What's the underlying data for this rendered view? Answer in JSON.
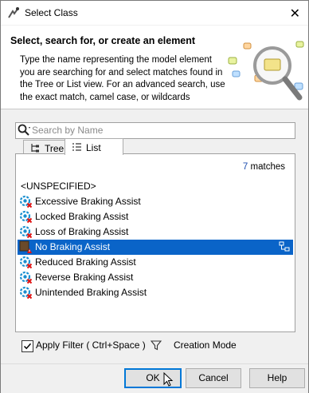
{
  "window": {
    "title": "Select Class",
    "close_label": "✕"
  },
  "header": {
    "heading": "Select, search for, or create an element",
    "description": "Type the name representing the model element you are searching for and select matches found in the Tree or List view. For an advanced search, use the exact match, camel case, or wildcards"
  },
  "search": {
    "placeholder": "Search by Name",
    "value": ""
  },
  "tabs": [
    {
      "label": "Tree"
    },
    {
      "label": "List"
    }
  ],
  "active_tab": "List",
  "results": {
    "match_count": "7",
    "match_label": "matches",
    "items": [
      {
        "label": "<UNSPECIFIED>",
        "icon": "none"
      },
      {
        "label": "Excessive Braking Assist",
        "icon": "class-error-icon"
      },
      {
        "label": "Locked Braking Assist",
        "icon": "class-error-icon"
      },
      {
        "label": "Loss of Braking Assist",
        "icon": "class-error-icon"
      },
      {
        "label": "No Braking Assist",
        "icon": "class-warning-icon",
        "selected": true
      },
      {
        "label": "Reduced Braking Assist",
        "icon": "class-error-icon"
      },
      {
        "label": "Reverse Braking Assist",
        "icon": "class-error-icon"
      },
      {
        "label": "Unintended Braking Assist",
        "icon": "class-error-icon"
      }
    ]
  },
  "filter": {
    "label": "Apply Filter ( Ctrl+Space )",
    "checked": true
  },
  "creation_mode": "Creation Mode",
  "buttons": {
    "ok": "OK",
    "cancel": "Cancel",
    "help": "Help"
  },
  "colors": {
    "selection": "#0a64c8",
    "accent": "#0078d7",
    "match_count": "#1e4fb0"
  }
}
